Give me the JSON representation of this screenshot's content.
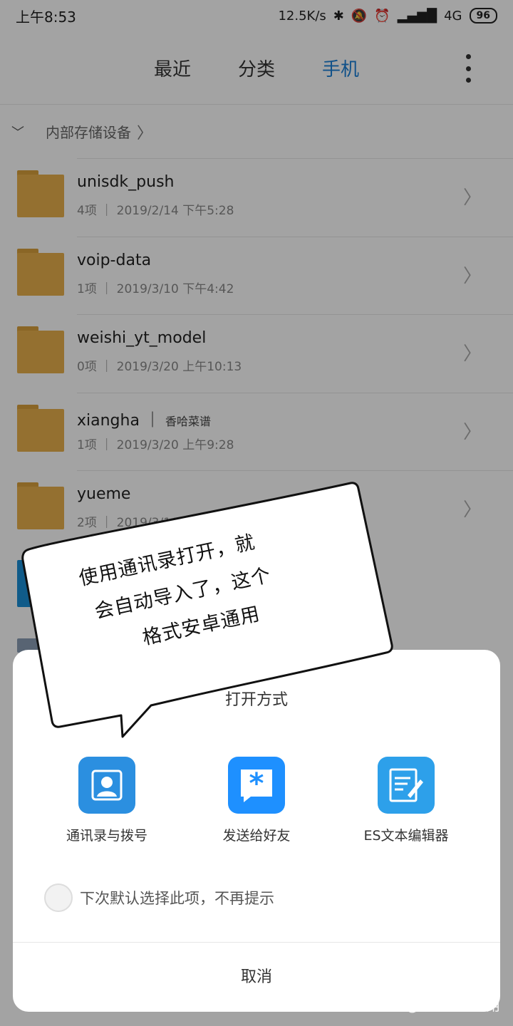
{
  "status_bar": {
    "time": "上午8:53",
    "net_speed": "12.5K/s",
    "network": "4G",
    "battery": "96"
  },
  "tabs": [
    {
      "label": "最近",
      "active": false
    },
    {
      "label": "分类",
      "active": false
    },
    {
      "label": "手机",
      "active": true
    }
  ],
  "breadcrumb": {
    "label": "内部存储设备"
  },
  "files": [
    {
      "name": "unisdk_push",
      "tag": "",
      "count": "4项",
      "date": "2019/2/14 下午5:28"
    },
    {
      "name": "voip-data",
      "tag": "",
      "count": "1项",
      "date": "2019/3/10 下午4:42"
    },
    {
      "name": "weishi_yt_model",
      "tag": "",
      "count": "0项",
      "date": "2019/3/20 上午10:13"
    },
    {
      "name": "xiangha",
      "tag": "香哈菜谱",
      "count": "1项",
      "date": "2019/3/20 上午9:28"
    },
    {
      "name": "yueme",
      "tag": "",
      "count": "2项",
      "date": "2019/3/16 下"
    }
  ],
  "sheet": {
    "title": "打开方式",
    "apps": [
      {
        "label": "通讯录与拨号",
        "icon": "contacts-icon",
        "color": "#2b8fe0"
      },
      {
        "label": "发送给好友",
        "icon": "asterisk-chat-icon",
        "color": "#1e90ff"
      },
      {
        "label": "ES文本编辑器",
        "icon": "es-editor-icon",
        "color": "#2da0ea"
      }
    ],
    "remember_label": "下次默认选择此项，不再提示",
    "cancel_label": "取消"
  },
  "annotation": {
    "line1": "使用通讯录打开，就",
    "line2": "会自动导入了，这个",
    "line3": "格式安卓通用"
  },
  "watermark": "知乎 @教育的副作用",
  "colors": {
    "accent": "#1a7fd6",
    "folder": "#e8b04c",
    "dim": "rgba(0,0,0,0.36)"
  }
}
